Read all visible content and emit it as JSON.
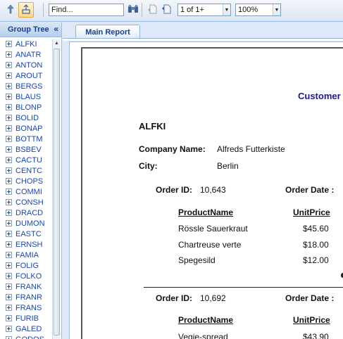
{
  "toolbar": {
    "find_placeholder": "Find...",
    "page_select": "1 of 1+",
    "zoom_select": "100%"
  },
  "sidebar": {
    "title": "Group Tree",
    "collapse_glyph": "«",
    "items": [
      "ALFKI",
      "ANATR",
      "ANTON",
      "AROUT",
      "BERGS",
      "BLAUS",
      "BLONP",
      "BOLID",
      "BONAP",
      "BOTTM",
      "BSBEV",
      "CACTU",
      "CENTC",
      "CHOPS",
      "COMMI",
      "CONSH",
      "DRACD",
      "DUMON",
      "EASTC",
      "ERNSH",
      "FAMIA",
      "FOLIG",
      "FOLKO",
      "FRANK",
      "FRANR",
      "FRANS",
      "FURIB",
      "GALED",
      "GODOS"
    ]
  },
  "tabs": {
    "main": "Main Report"
  },
  "report": {
    "title": "Customer",
    "customer_id": "ALFKI",
    "company_label": "Company Name:",
    "company_value": "Alfreds Futterkiste",
    "city_label": "City:",
    "city_value": "Berlin",
    "order_id_label": "Order ID:",
    "order_date_label": "Order Date :",
    "product_header": "ProductName",
    "price_header": "UnitPrice",
    "orders": [
      {
        "id": "10,643",
        "lines": [
          {
            "product": "Rössle Sauerkraut",
            "price": "$45.60"
          },
          {
            "product": "Chartreuse verte",
            "price": "$18.00"
          },
          {
            "product": "Spegesild",
            "price": "$12.00"
          }
        ]
      },
      {
        "id": "10,692",
        "lines": [
          {
            "product": "Vegie-spread",
            "price": "$43.90"
          }
        ]
      }
    ]
  }
}
